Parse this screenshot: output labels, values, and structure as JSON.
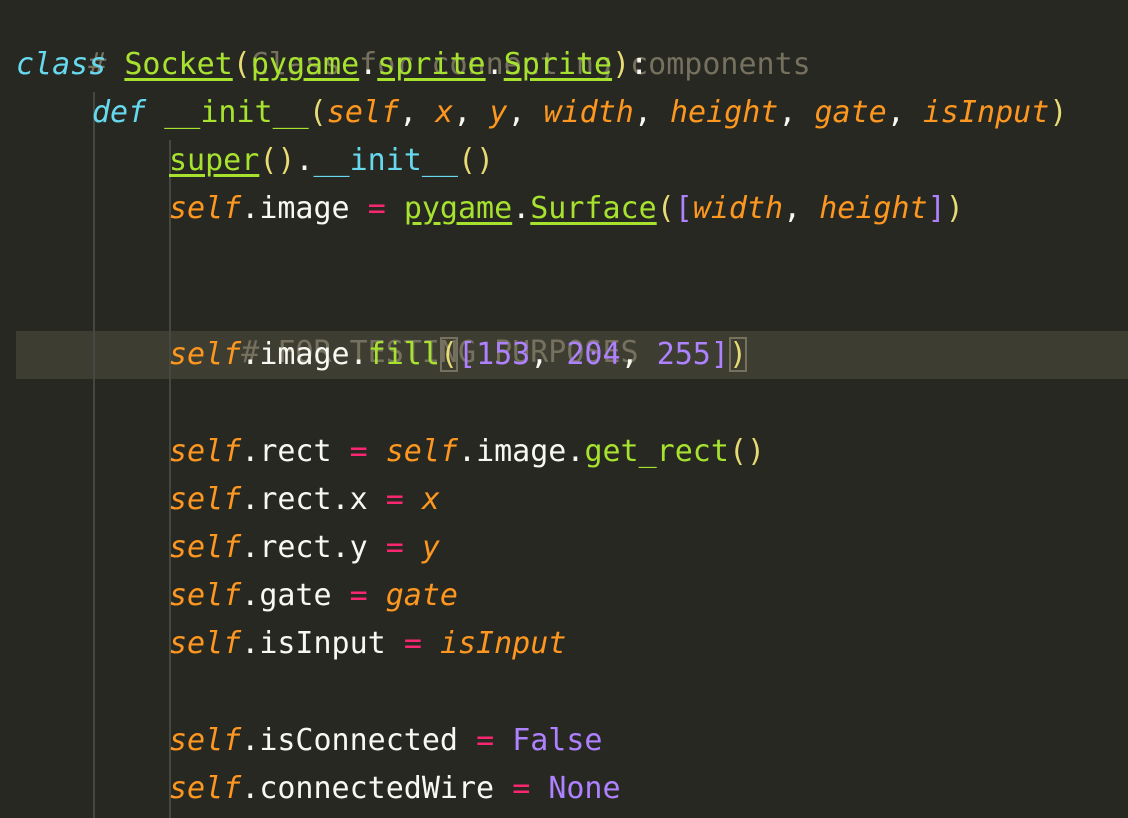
{
  "editor": {
    "theme_colors": {
      "background": "#272822",
      "comment": "#75715e",
      "keyword": "#66d9ef",
      "class_name": "#a6e22e",
      "parameter": "#fd971f",
      "operator": "#f92672",
      "number": "#ae81ff",
      "text": "#f8f8f2"
    },
    "lines": [
      {
        "comment": "# Socket Class for connecting components"
      },
      {
        "kw": "class",
        "name": "Socket",
        "mod": "pygame",
        "sub": "sprite",
        "base": "Sprite",
        "end": "):"
      },
      {
        "kw": "def",
        "name": "__init__",
        "params": [
          "self",
          "x",
          "y",
          "width",
          "height",
          "gate",
          "isInput"
        ]
      },
      {
        "call": "super",
        "name": "__init__"
      },
      {
        "self": "self",
        "attr": "image",
        "mod": "pygame",
        "cls": "Surface",
        "args": [
          "width",
          "height"
        ]
      },
      {
        "comment": "# FOR TESTING PURPOSES"
      },
      {
        "self": "self",
        "attr": "image",
        "method": "fill",
        "values": [
          "153",
          "204",
          "255"
        ]
      },
      {
        "self": "self",
        "attr": "rect",
        "rhs_self": "self",
        "rhs_attr": "image",
        "method": "get_rect"
      },
      {
        "self": "self",
        "attr": "rect.x",
        "value": "x"
      },
      {
        "self": "self",
        "attr": "rect.y",
        "value": "y"
      },
      {
        "self": "self",
        "attr": "gate",
        "value": "gate"
      },
      {
        "self": "self",
        "attr": "isInput",
        "value": "isInput"
      },
      {
        "self": "self",
        "attr": "isConnected",
        "value": "False"
      },
      {
        "self": "self",
        "attr": "connectedWire",
        "value": "None"
      }
    ]
  }
}
